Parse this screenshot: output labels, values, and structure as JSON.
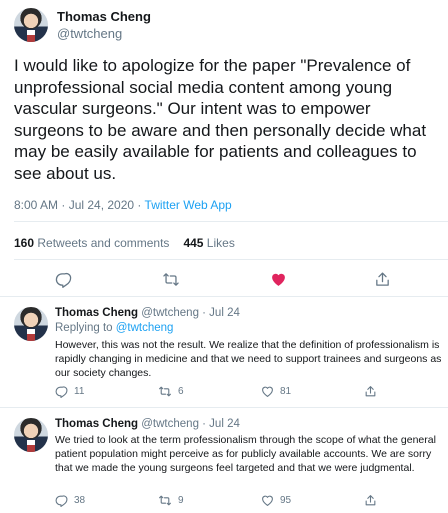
{
  "main_tweet": {
    "author_name": "Thomas Cheng",
    "author_handle": "@twtcheng",
    "text": "I would like to apologize for the paper \"Prevalence of unprofessional social media content among young vascular surgeons.\" Our intent was to empower surgeons to be aware and then personally decide what may be easily available for patients and colleagues to see about us.",
    "timestamp": "8:00 AM · Jul 24, 2020 · ",
    "source": "Twitter Web App",
    "retweets_count": "160",
    "retweets_label": " Retweets and comments",
    "likes_count": "445",
    "likes_label": " Likes",
    "liked": true,
    "colors": {
      "like": "#e0245e",
      "link": "#1da1f2",
      "muted": "#657786"
    }
  },
  "replies": [
    {
      "author_name": "Thomas Cheng",
      "meta": " @twtcheng · Jul 24",
      "replying_prefix": "Replying to ",
      "replying_handle": "@twtcheng",
      "text": "However, this was not the result. We realize that the definition of professionalism is rapidly changing in medicine and that we need to support trainees and surgeons as our society changes.",
      "reply_count": "11",
      "retweet_count": "6",
      "like_count": "81"
    },
    {
      "author_name": "Thomas Cheng",
      "meta": " @twtcheng · Jul 24",
      "text": "We tried to look at the term professionalism through the scope of what the general patient population might perceive as for publicly available accounts. We are sorry that we made the young surgeons feel targeted and that we were judgmental.",
      "reply_count": "38",
      "retweet_count": "9",
      "like_count": "95"
    }
  ],
  "icons": {
    "reply": "reply-icon",
    "retweet": "retweet-icon",
    "like": "heart-icon",
    "share": "share-icon"
  }
}
